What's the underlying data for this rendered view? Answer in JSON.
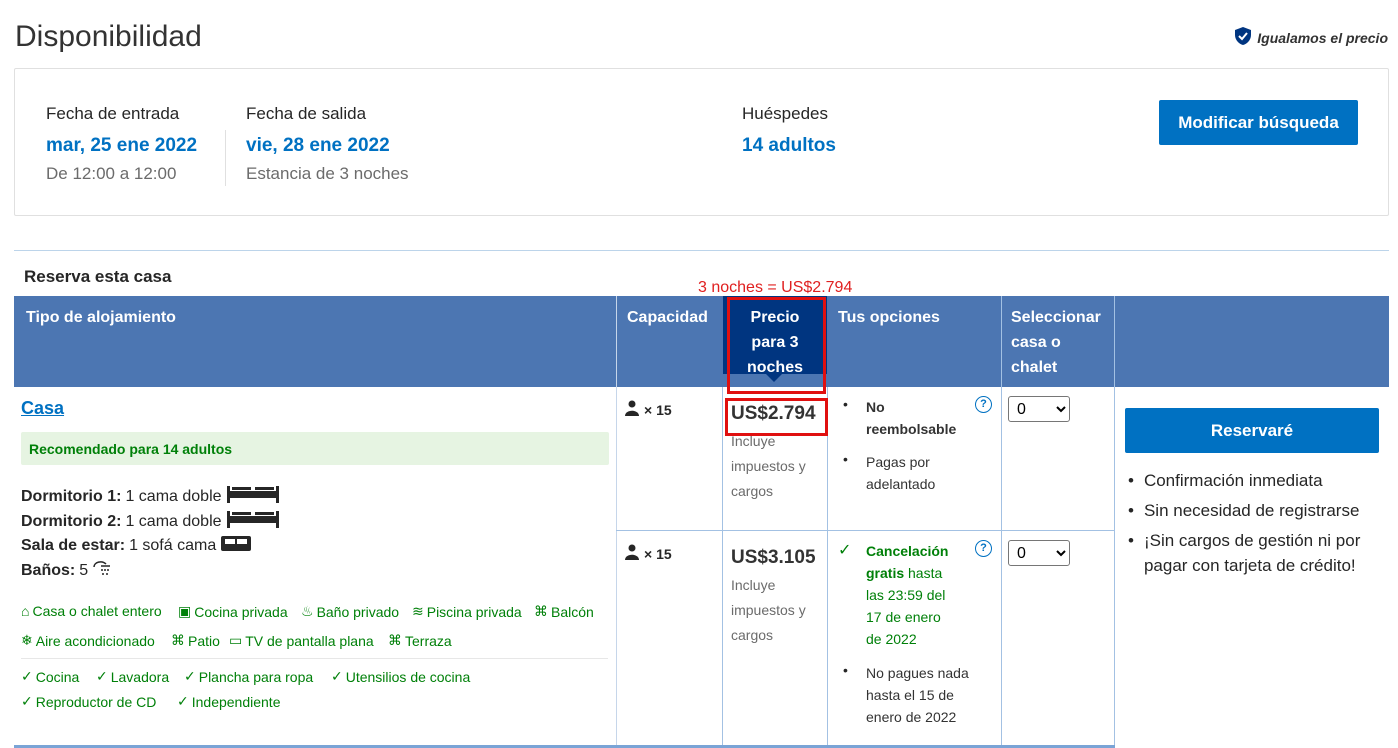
{
  "page": {
    "title": "Disponibilidad",
    "price_match": "Igualamos el precio",
    "section_title": "Reserva esta casa",
    "annotation": "3 noches = US$2.794"
  },
  "search": {
    "checkin_label": "Fecha de entrada",
    "checkin_value": "mar, 25 ene 2022",
    "checkin_sub": "De 12:00 a 12:00",
    "checkout_label": "Fecha de salida",
    "checkout_value": "vie, 28 ene 2022",
    "checkout_sub": "Estancia de 3 noches",
    "guests_label": "Huéspedes",
    "guests_value": "14 adultos",
    "modify_label": "Modificar búsqueda"
  },
  "table": {
    "headers": {
      "type": "Tipo de alojamiento",
      "capacity": "Capacidad",
      "price_line1": "Precio",
      "price_line2": "para 3",
      "price_line3": "noches",
      "options": "Tus opciones",
      "select_line1": "Seleccionar",
      "select_line2": "casa o",
      "select_line3": "chalet"
    },
    "room": {
      "name": "Casa",
      "recommended": "Recomendado para 14 adultos",
      "beds": [
        {
          "label": "Dormitorio 1:",
          "value": "1 cama doble"
        },
        {
          "label": "Dormitorio 2:",
          "value": "1 cama doble"
        },
        {
          "label": "Sala de estar:",
          "value": "1 sofá cama"
        },
        {
          "label": "Baños:",
          "value": "5"
        }
      ],
      "facilities": [
        "Casa o chalet entero",
        "Cocina privada",
        "Baño privado",
        "Piscina privada",
        "Balcón",
        "Aire acondicionado",
        "Patio",
        "TV de pantalla plana",
        "Terraza"
      ],
      "amenities": [
        "Cocina",
        "Lavadora",
        "Plancha para ropa",
        "Utensilios de cocina",
        "Reproductor de CD",
        "Independiente"
      ]
    },
    "rows": [
      {
        "capacity": "× 15",
        "price": "US$2.794",
        "price_sub1": "Incluye",
        "price_sub2": "impuestos y",
        "price_sub3": "cargos",
        "opt1_line1": "No",
        "opt1_line2": "reembolsable",
        "opt2_line1": "Pagas por",
        "opt2_line2": "adelantado",
        "select_value": "0"
      },
      {
        "capacity": "× 15",
        "price": "US$3.105",
        "price_sub1": "Incluye",
        "price_sub2": "impuestos y",
        "price_sub3": "cargos",
        "opt1_line1": "Cancelación",
        "opt1_line2a": "gratis",
        "opt1_line2b": " hasta",
        "opt1_line3": "las 23:59 del",
        "opt1_line4": "17 de enero",
        "opt1_line5": "de 2022",
        "opt2_line1": "No pagues nada",
        "opt2_line2": "hasta el 15 de",
        "opt2_line3": "enero de 2022",
        "select_value": "0"
      }
    ]
  },
  "reserve": {
    "button": "Reservaré",
    "perks": [
      "Confirmación inmediata",
      "Sin necesidad de registrarse",
      "¡Sin cargos de gestión ni por pagar con tarjeta de crédito!"
    ]
  },
  "colors": {
    "brand_blue": "#0071c2",
    "header_blue": "#4c76b2",
    "dark_blue": "#003580",
    "green": "#008009",
    "annotation_red": "#e02020"
  }
}
